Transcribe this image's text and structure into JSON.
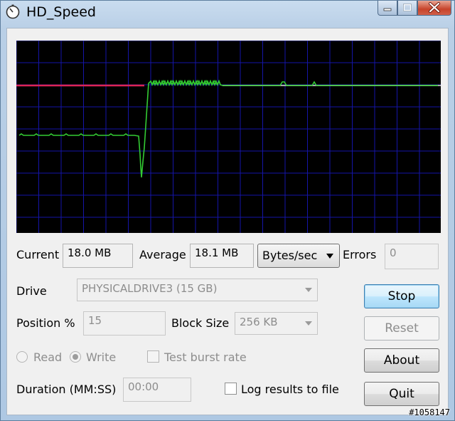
{
  "window": {
    "title": "HD_Speed",
    "icon": "stopwatch-icon",
    "controls": [
      "minimize-icon",
      "maximize-icon",
      "close-icon"
    ]
  },
  "graph": {
    "background": "#000000",
    "grid_color": "#1515a8",
    "series": [
      {
        "role": "speed-trace",
        "color": "#33cc33"
      },
      {
        "role": "average-trace",
        "color": "#dc2456"
      },
      {
        "role": "average-trace-late",
        "color": "#a8a8a8"
      }
    ]
  },
  "stats": {
    "current_label": "Current",
    "current_value": "18.0 MB",
    "average_label": "Average",
    "average_value": "18.1 MB",
    "units_selected": "Bytes/sec",
    "errors_label": "Errors",
    "errors_value": "0"
  },
  "settings": {
    "drive_label": "Drive",
    "drive_value": "PHYSICALDRIVE3 (15 GB)",
    "position_label": "Position %",
    "position_value": "15",
    "block_size_label": "Block Size",
    "block_size_value": "256 KB",
    "read_label": "Read",
    "write_label": "Write",
    "mode_selected": "Write",
    "burst_label": "Test burst rate",
    "duration_label": "Duration (MM:SS)",
    "duration_value": "00:00",
    "log_label": "Log results to file"
  },
  "buttons": {
    "stop": "Stop",
    "reset": "Reset",
    "about": "About",
    "quit": "Quit"
  },
  "watermark": "#1058147"
}
